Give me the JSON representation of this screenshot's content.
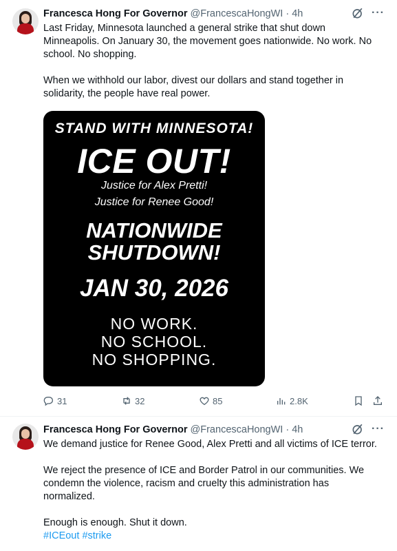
{
  "tweets": [
    {
      "author_name": "Francesca Hong For Governor",
      "handle": "@FrancescaHongWI",
      "sep": "·",
      "time": "4h",
      "more": "···",
      "text": [
        "Last Friday, Minnesota launched a general strike that shut down",
        "Minneapolis. On January 30, the movement goes nationwide. No work. No",
        "school. No shopping.",
        "When we withhold our labor, divest our dollars and stand together in",
        "solidarity, the people have real power."
      ],
      "media": {
        "line1": "STAND WITH MINNESOTA!",
        "line2": "ICE OUT!",
        "line3": "Justice for Alex Pretti!",
        "line4": "Justice for Renee Good!",
        "line5": "NATIONWIDE",
        "line6": "SHUTDOWN!",
        "line7": "JAN 30, 2026",
        "line8": "NO WORK.",
        "line9": "NO SCHOOL.",
        "line10": "NO SHOPPING."
      },
      "actions": {
        "replies": "31",
        "reposts": "32",
        "likes": "85",
        "views": "2.8K"
      }
    },
    {
      "author_name": "Francesca Hong For Governor",
      "handle": "@FrancescaHongWI",
      "sep": "·",
      "time": "4h",
      "more": "···",
      "text": [
        "We demand justice for Renee Good, Alex Pretti and all victims of ICE terror.",
        "We reject the presence of ICE and Border Patrol in our communities. We",
        "condemn the violence, racism and cruelty this administration has",
        "normalized.",
        "Enough is enough. Shut it down."
      ],
      "hashtags": [
        "#ICEout",
        "#strike"
      ]
    }
  ],
  "colors": {
    "link": "#1d9bf0",
    "muted": "#536471",
    "text": "#0f1419"
  }
}
